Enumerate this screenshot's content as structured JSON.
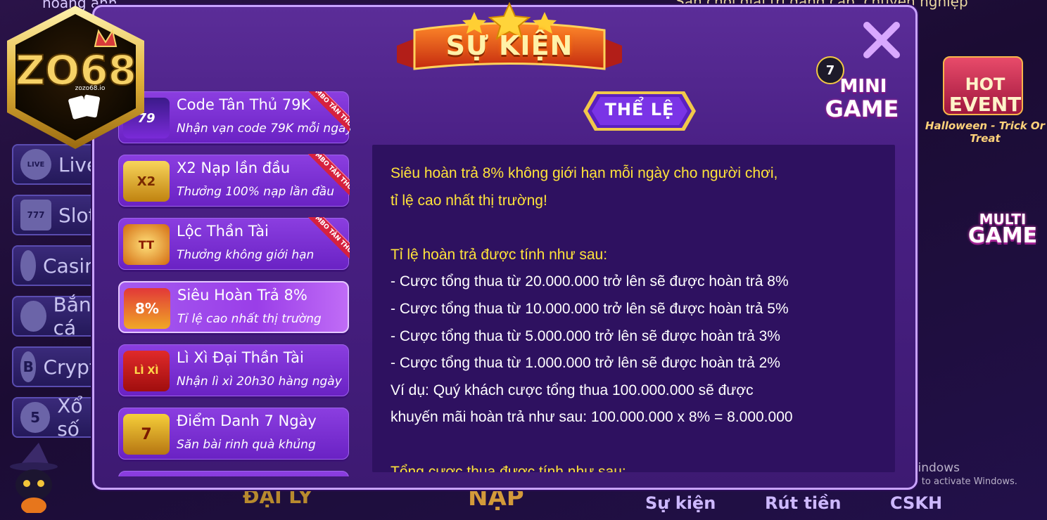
{
  "background": {
    "top_left_text": "hoàng anh",
    "top_right_text": "Sân chơi giải trí đẳng cấp, chuyên nghiệp",
    "sidebar_items": [
      {
        "label": "Live",
        "icon": "live-icon",
        "badge": "LIVE"
      },
      {
        "label": "Slots",
        "icon": "slot-777-icon",
        "badge": "777"
      },
      {
        "label": "Casino",
        "icon": "poker-chip-icon",
        "badge": ""
      },
      {
        "label": "Bắn cá",
        "icon": "fish-icon",
        "badge": ""
      },
      {
        "label": "Crypto",
        "icon": "bitcoin-icon",
        "badge": "B"
      },
      {
        "label": "Xổ số",
        "icon": "lottery-icon",
        "badge": "5"
      }
    ],
    "hot_event": {
      "line1": "HOT",
      "line2": "EVENT",
      "line3": "Halloween - Trick Or Treat"
    },
    "multi_game": {
      "line1": "MULTI",
      "line2": "GAME"
    },
    "bottom_nav": {
      "agent": "ĐẠI LÝ",
      "deposit": "NẠP",
      "events": "Sự kiện",
      "withdraw": "Rút tiền",
      "support": "CSKH"
    }
  },
  "logo": {
    "brand": "ZO68",
    "sub": "zozo68.io"
  },
  "modal": {
    "title": "SỰ KIỆN",
    "rules_button": "THỂ LỆ",
    "events": [
      {
        "title": "Code Tân Thủ 79K",
        "subtitle": "Nhận vạn code 79K mỗi ngày",
        "tag": "COMBO TÂN THỦ",
        "thumb": "79"
      },
      {
        "title": "X2 Nạp lần đầu",
        "subtitle": "Thưởng 100% nạp lần đầu",
        "tag": "COMBO TÂN THỦ",
        "thumb": "X2"
      },
      {
        "title": "Lộc Thần Tài",
        "subtitle": "Thưởng không giới hạn",
        "tag": "COMBO TÂN THỦ",
        "thumb": "TT"
      },
      {
        "title": "Siêu Hoàn Trả 8%",
        "subtitle": "Tỉ lệ cao nhất thị trường",
        "tag": "",
        "thumb": "8%"
      },
      {
        "title": "Lì Xì Đại Thần Tài",
        "subtitle": "Nhận lì xì 20h30 hàng ngày",
        "tag": "",
        "thumb": "LÌ XÌ"
      },
      {
        "title": "Điểm Danh 7 Ngày",
        "subtitle": "Săn bài rinh quà khủng",
        "tag": "",
        "thumb": "7"
      }
    ],
    "content_lines": [
      {
        "text": "Siêu hoàn trả 8% không giới hạn mỗi ngày cho người chơi,",
        "color": "yellow"
      },
      {
        "text": "tỉ lệ cao nhất thị trường!",
        "color": "yellow"
      },
      {
        "text": "",
        "color": "white"
      },
      {
        "text": "Tỉ lệ hoàn trả được tính như sau:",
        "color": "yellow"
      },
      {
        "text": "- Cược tổng thua từ 20.000.000 trở lên sẽ được hoàn trả 8%",
        "color": "white"
      },
      {
        "text": "- Cược tổng thua từ 10.000.000 trở lên sẽ được hoàn trả 5%",
        "color": "white"
      },
      {
        "text": "- Cược tổng thua từ 5.000.000 trở lên sẽ được hoàn trả 3%",
        "color": "white"
      },
      {
        "text": "- Cược tổng thua từ 1.000.000 trở lên sẽ được hoàn trả 2%",
        "color": "white"
      },
      {
        "text": "Ví dụ: Quý khách cược tổng thua 100.000.000 sẽ được",
        "color": "white"
      },
      {
        "text": "khuyến mãi hoàn trả như sau: 100.000.000 x 8% = 8.000.000",
        "color": "white"
      },
      {
        "text": "",
        "color": "white"
      },
      {
        "text": "Tổng cược thua được tính như sau:",
        "color": "yellow"
      }
    ]
  },
  "mini_game": {
    "badge": "7",
    "line1": "MINI",
    "line2": "GAME"
  },
  "activate_windows": {
    "line1": "Activate Windows",
    "line2": "Go to Settings to activate Windows."
  },
  "colors": {
    "modal_bg": "#4a2085",
    "yellow_text": "#ffe33a",
    "panel_bg": "#2e1160",
    "accent_red": "#d6213e"
  }
}
